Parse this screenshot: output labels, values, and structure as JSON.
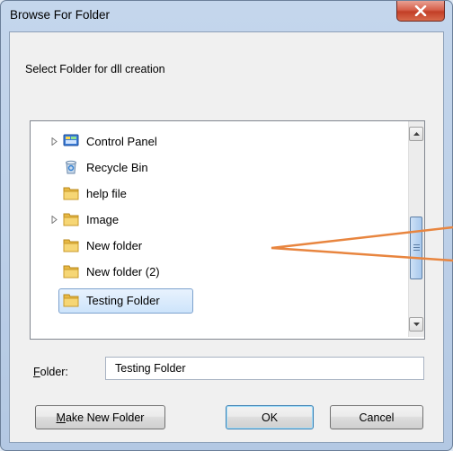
{
  "window": {
    "title": "Browse For Folder",
    "prompt": "Select Folder for dll creation"
  },
  "tree": {
    "items": [
      {
        "label": "Control Panel",
        "icon": "control-panel-icon",
        "expandable": true
      },
      {
        "label": "Recycle Bin",
        "icon": "recycle-bin-icon",
        "expandable": false
      },
      {
        "label": "help file",
        "icon": "folder-icon",
        "expandable": false
      },
      {
        "label": "Image",
        "icon": "folder-icon",
        "expandable": true
      },
      {
        "label": "New folder",
        "icon": "folder-icon",
        "expandable": false
      },
      {
        "label": "New folder (2)",
        "icon": "folder-icon",
        "expandable": false
      },
      {
        "label": "Testing Folder",
        "icon": "folder-icon",
        "expandable": false,
        "selected": true
      }
    ]
  },
  "folder_field": {
    "label_prefix": "F",
    "label_rest": "older:",
    "value": "Testing Folder"
  },
  "buttons": {
    "make_new_folder_prefix": "M",
    "make_new_folder_rest": "ake New Folder",
    "ok": "OK",
    "cancel": "Cancel"
  },
  "colors": {
    "selection": "#cde4fb",
    "annotation_arrow": "#e8853f",
    "close_button": "#c23e26"
  }
}
